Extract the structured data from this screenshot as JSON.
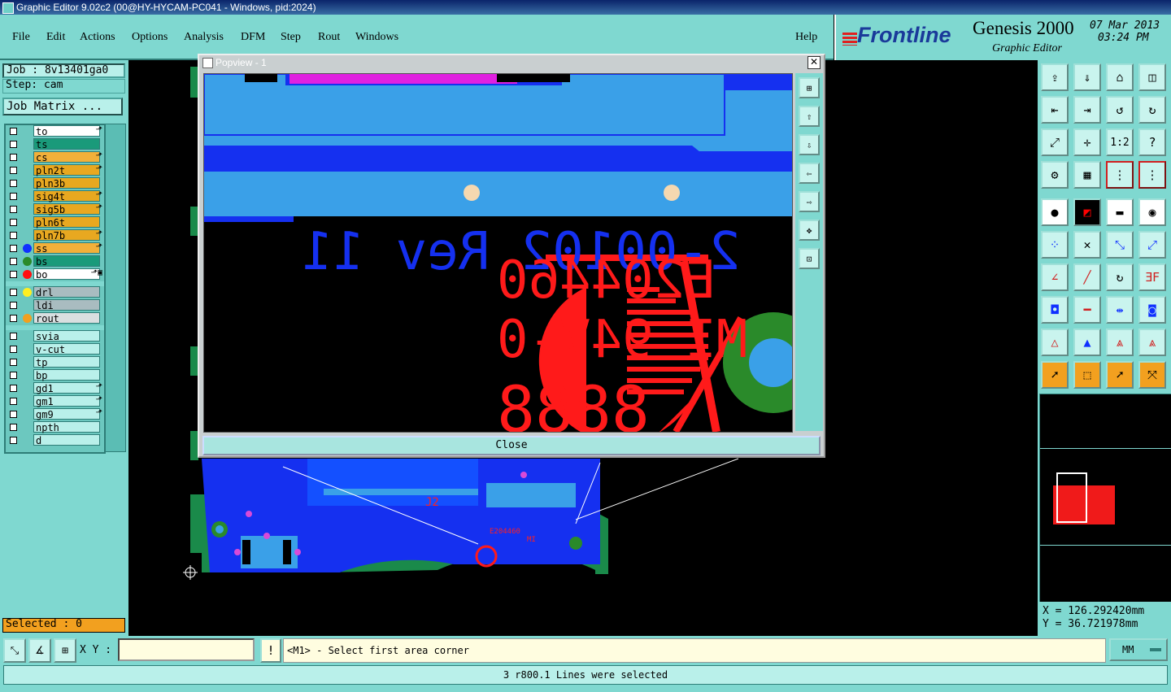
{
  "window": {
    "title": "Graphic Editor 9.02c2 (00@HY-HYCAM-PC041 - Windows, pid:2024)"
  },
  "menu": [
    {
      "label": "File"
    },
    {
      "label": "Edit"
    },
    {
      "label": "Actions"
    },
    {
      "label": "Options"
    },
    {
      "label": "Analysis"
    },
    {
      "label": "DFM"
    },
    {
      "label": "Step"
    },
    {
      "label": "Rout"
    },
    {
      "label": "Windows"
    }
  ],
  "help_label": "Help",
  "brand": {
    "logo": "Frontline",
    "product": "Genesis 2000",
    "subtitle": "Graphic Editor",
    "date": "07 Mar 2013",
    "time": "03:24 PM"
  },
  "job": {
    "job_text": "Job : 8v13401ga0",
    "step_text": "Step: cam",
    "matrix_button": "Job Matrix ..."
  },
  "layers": [
    {
      "name": "to",
      "color": "#ffffff",
      "edit": "⬏",
      "dot": ""
    },
    {
      "name": "ts",
      "color": "#1a9a7a",
      "edit": "",
      "dot": ""
    },
    {
      "name": "cs",
      "color": "#f2b03a",
      "edit": "⬏",
      "dot": ""
    },
    {
      "name": "pln2t",
      "color": "#e8a820",
      "edit": "⬏",
      "dot": ""
    },
    {
      "name": "pln3b",
      "color": "#e8a820",
      "edit": "",
      "dot": ""
    },
    {
      "name": "sig4t",
      "color": "#e8a820",
      "edit": "⬏",
      "dot": ""
    },
    {
      "name": "sig5b",
      "color": "#e8a820",
      "edit": "⬏",
      "dot": ""
    },
    {
      "name": "pln6t",
      "color": "#e8a820",
      "edit": "",
      "dot": ""
    },
    {
      "name": "pln7b",
      "color": "#e8a820",
      "edit": "⬏",
      "dot": ""
    },
    {
      "name": "ss",
      "color": "#f2b03a",
      "edit": "⬏",
      "dot": "#1030ff"
    },
    {
      "name": "bs",
      "color": "#1a9a7a",
      "edit": "",
      "dot": "#2a8a2a"
    },
    {
      "name": "bo",
      "color": "#ffffff",
      "edit": "⬏▣",
      "dot": "#ff1010"
    }
  ],
  "drill_layers": [
    {
      "name": "drl",
      "color": "#a9bcc0",
      "dot": "#ffee22"
    },
    {
      "name": "ldi",
      "color": "#a9bcc0",
      "dot": ""
    },
    {
      "name": "rout",
      "color": "#d9dfe0",
      "dot": "#f2a01f"
    }
  ],
  "misc_layers": [
    {
      "name": "svia",
      "edit": ""
    },
    {
      "name": "v-cut",
      "edit": ""
    },
    {
      "name": "tp",
      "edit": ""
    },
    {
      "name": "bp",
      "edit": ""
    },
    {
      "name": "gd1",
      "edit": "⬏"
    },
    {
      "name": "gm1",
      "edit": "⬏"
    },
    {
      "name": "gm9",
      "edit": "⬏"
    },
    {
      "name": "npth",
      "edit": ""
    },
    {
      "name": "d",
      "edit": ""
    }
  ],
  "selected_text": "Selected : 0",
  "popup": {
    "title": "Popview - 1",
    "close_label": "Close",
    "silk_text_1": "2-00102 Rev 11",
    "silk_text_2": "E204460",
    "silk_text_3": "MI 94V-0",
    "silk_text_4": "8888"
  },
  "board": {
    "label_j2": "J2",
    "label_e": "E204460",
    "label_mi": "MI"
  },
  "coords": {
    "x": "X = 126.292420mm",
    "y": "Y = 36.721978mm"
  },
  "statusbar": {
    "xy_label": "X Y :",
    "xy_value": "",
    "prompt": "<M1> - Select first area corner",
    "units": "MM",
    "message": "3 r800.1 Lines were selected"
  }
}
